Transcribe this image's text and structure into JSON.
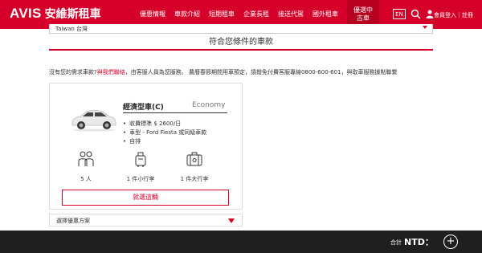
{
  "header": {
    "brand": "AVIS",
    "brand_cn": "安維斯租車",
    "nav": [
      {
        "label": "優惠情報"
      },
      {
        "label": "車款介紹"
      },
      {
        "label": "短期租車"
      },
      {
        "label": "企業長租"
      },
      {
        "label": "接送代駕"
      },
      {
        "label": "國外租車"
      },
      {
        "label": "優選中古車"
      }
    ],
    "lang": "EN",
    "account": "會員登入｜註冊",
    "icons": [
      "search-icon",
      "user-icon"
    ],
    "accent_color": "#d4002a"
  },
  "country_bar": {
    "value": "Taiwan 台灣"
  },
  "section_title": "符合您條件的車款",
  "notice": {
    "before": "沒有您的需求車款?",
    "link": "與我們聯絡",
    "after": "，由客服人員為您服務。 農曆春節期間用車預定，請撥免付費客服專線0800-600-601，與取車服務據點聯繫"
  },
  "car": {
    "title": "經濟型車(C)",
    "class": "Economy",
    "features": [
      "收費標準 $ 2600/日",
      "車型 - Ford Fiesta 或同級車款",
      "自排"
    ],
    "amenities": [
      {
        "icon": "passengers-icon",
        "label": "5 人"
      },
      {
        "icon": "small-luggage-icon",
        "label": "1 件小行李"
      },
      {
        "icon": "large-luggage-icon",
        "label": "1 件大行李"
      }
    ],
    "select_label": "就選這輛"
  },
  "promo": {
    "label": "選擇優惠方案"
  },
  "footer": {
    "total_label": "合計",
    "currency": "NTD：",
    "add_label": "+"
  }
}
